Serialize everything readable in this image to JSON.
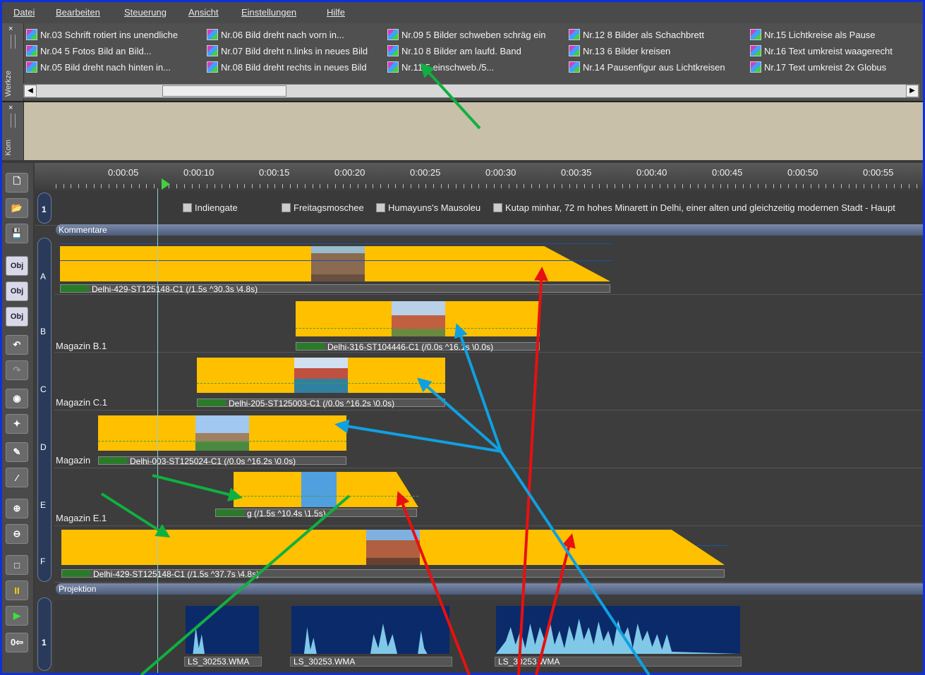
{
  "menu": [
    "Datei",
    "Bearbeiten",
    "Steuerung",
    "Ansicht",
    "Einstellungen",
    "Hilfe"
  ],
  "tools_panel": {
    "side_label": "Werkze",
    "close": "×",
    "effects": [
      "Nr.03 Schrift rotiert ins unendliche",
      "Nr.04  5 Fotos Bild an Bild...",
      "Nr.05  Bild dreht nach hinten in...",
      "Nr.06  Bild dreht nach vorn in...",
      "Nr.07 Bild dreht n.links in neues Bild",
      "Nr.08 Bild dreht rechts in neues Bild",
      "Nr.09  5 Bilder schweben schräg ein",
      "Nr.10  8 Bilder am laufd. Band",
      "Nr.11  5 einschweb./5...",
      "Nr.12  8 Bilder als Schachbrett",
      "Nr.13  6 Bilder kreisen",
      "Nr.14 Pausenfigur aus Lichtkreisen",
      "Nr.15 Lichtkreise als Pause",
      "Nr.16 Text umkreist waagerecht",
      "Nr.17 Text umkreist 2x Globus"
    ]
  },
  "kommentar_panel": {
    "side_label": "Kom",
    "close": "×"
  },
  "toolbar_buttons": [
    "new-file",
    "open-folder",
    "save-disk",
    "Obj+",
    "Obj?",
    "Obj-",
    "undo",
    "redo",
    "effect",
    "image-effect",
    "brush",
    "eyedropper",
    "zoom-in",
    "zoom-out",
    "frame",
    "pause",
    "play",
    "zero-time"
  ],
  "toolbar_text": {
    "obj_add": "Obj",
    "obj_prop": "Obj",
    "obj_remove": "Obj",
    "pause": "II",
    "zero": "0⇦"
  },
  "ruler": [
    "0:00:05",
    "0:00:10",
    "0:00:15",
    "0:00:20",
    "0:00:25",
    "0:00:30",
    "0:00:35",
    "0:00:40",
    "0:00:45",
    "0:00:50",
    "0:00:55"
  ],
  "comments": {
    "track_number": "1",
    "items": [
      "Indiengate",
      "Freitagsmoschee",
      "Humayuns's Mausoleu",
      "Kutap minhar, 72 m hohes Minarett in Delhi, einer alten und gleichzeitig modernen Stadt -  Haupt"
    ],
    "section": "Kommentare"
  },
  "tracks": [
    {
      "letter": "A",
      "magazine": "",
      "clip": "Delhi-429-ST125148-C1 (/1.5s ^30.3s \\4.8s)"
    },
    {
      "letter": "B",
      "magazine": "Magazin B.1",
      "clip": "Delhi-316-ST104446-C1 (/0.0s ^16.1s \\0.0s)"
    },
    {
      "letter": "C",
      "magazine": "Magazin C.1",
      "clip": "Delhi-205-ST125003-C1 (/0.0s ^16.2s \\0.0s)"
    },
    {
      "letter": "D",
      "magazine": "Magazin",
      "clip": "Delhi-003-ST125024-C1 (/0.0s ^16.2s \\0.0s)"
    },
    {
      "letter": "E",
      "magazine": "Magazin E.1",
      "clip": "g (/1.5s ^10.4s \\1.5s)"
    },
    {
      "letter": "F",
      "magazine": "",
      "clip": "Delhi-429-ST125148-C1 (/1.5s ^37.7s \\4.8s)"
    }
  ],
  "projection": {
    "section": "Projektion",
    "track_number": "1"
  },
  "audio": [
    "LS_30253.WMA",
    "LS_30253.WMA",
    "LS_30253.WMA"
  ],
  "colors": {
    "clip": "#ffc000",
    "frame": "#1030d8",
    "arrow_green": "#10b040",
    "arrow_red": "#e81010",
    "arrow_blue": "#10a0e0",
    "wave": "#0a2a6a"
  }
}
